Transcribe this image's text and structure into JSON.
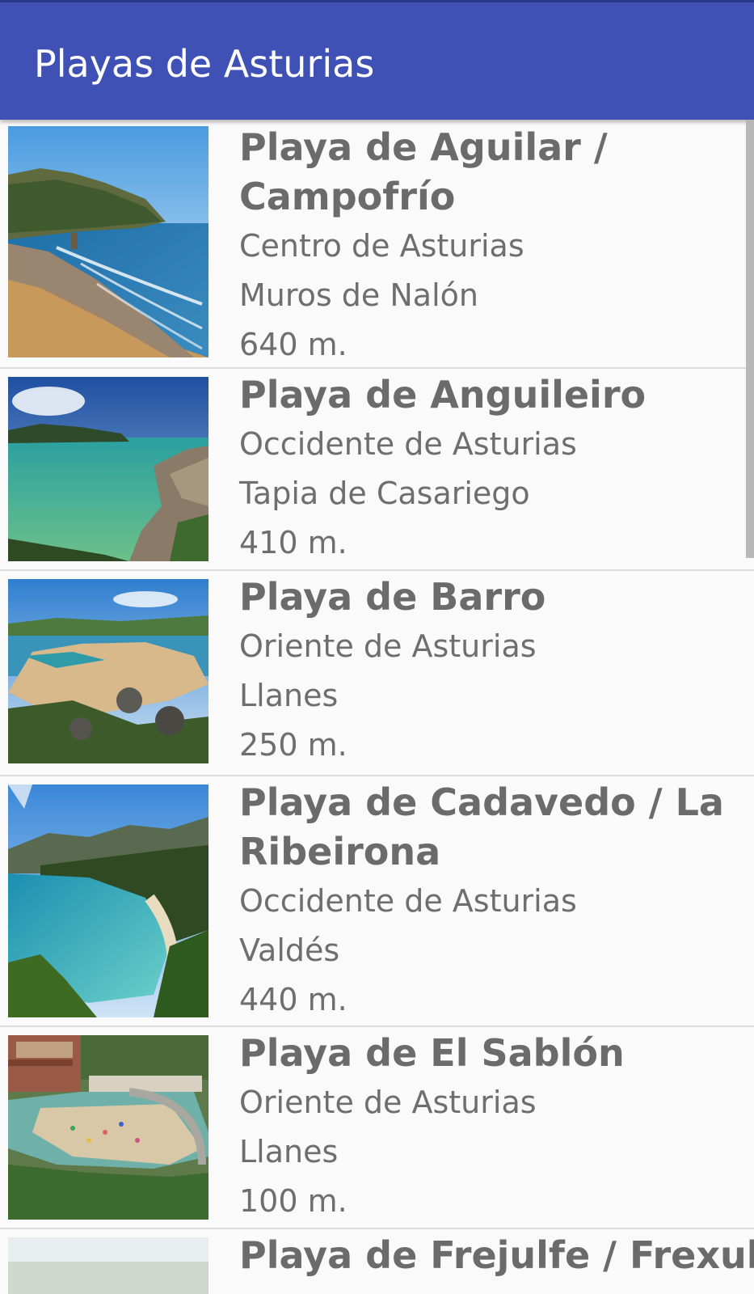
{
  "app": {
    "title": "Playas de Asturias"
  },
  "beaches": [
    {
      "name": "Playa de Aguilar / Campofrío",
      "zone": "Centro de Asturias",
      "municipality": "Muros de Nalón",
      "length": "640 m."
    },
    {
      "name": "Playa de Anguileiro",
      "zone": "Occidente de Asturias",
      "municipality": "Tapia de Casariego",
      "length": "410 m."
    },
    {
      "name": "Playa de Barro",
      "zone": "Oriente de Asturias",
      "municipality": "Llanes",
      "length": "250 m."
    },
    {
      "name": "Playa de Cadavedo / La Ribeirona",
      "zone": "Occidente de Asturias",
      "municipality": "Valdés",
      "length": "440 m."
    },
    {
      "name": "Playa de El Sablón",
      "zone": "Oriente de Asturias",
      "municipality": "Llanes",
      "length": "100 m."
    },
    {
      "name": "Playa de Frejulfe / Frexulfe",
      "zone": "",
      "municipality": "",
      "length": ""
    }
  ],
  "colors": {
    "appbar": "#3f51b5",
    "status": "#2b3a8c",
    "title_text": "#6b6b6b",
    "detail_text": "#6e6e6e",
    "divider": "#dcdcdc"
  }
}
